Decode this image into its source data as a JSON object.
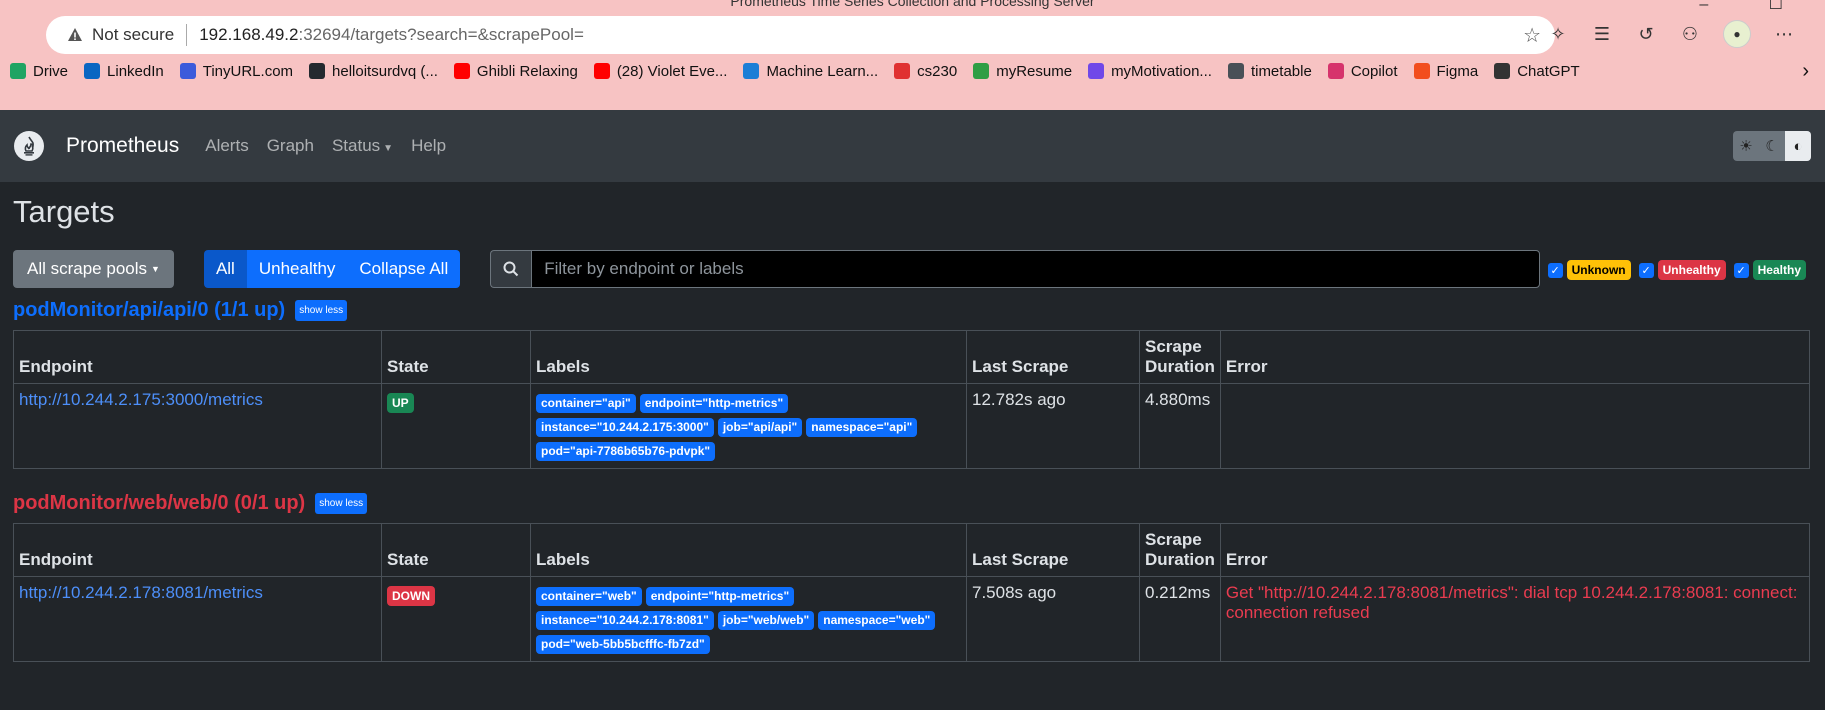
{
  "browser": {
    "window_title": "Prometheus Time Series Collection and Processing Server",
    "not_secure": "Not secure",
    "url_host": "192.168.49.2",
    "url_rest": ":32694/targets?search=&scrapePool=",
    "bookmarks": [
      {
        "label": "Drive",
        "color": "#1fa463"
      },
      {
        "label": "LinkedIn",
        "color": "#0a66c2"
      },
      {
        "label": "TinyURL.com",
        "color": "#3b5bdb"
      },
      {
        "label": "helloitsurdvq (...",
        "color": "#24292f"
      },
      {
        "label": "Ghibli Relaxing",
        "color": "#ff0000"
      },
      {
        "label": "(28) Violet Eve...",
        "color": "#ff0000"
      },
      {
        "label": "Machine Learn...",
        "color": "#1c7ed6"
      },
      {
        "label": "cs230",
        "color": "#e03131"
      },
      {
        "label": "myResume",
        "color": "#2f9e44"
      },
      {
        "label": "myMotivation...",
        "color": "#7048e8"
      },
      {
        "label": "timetable",
        "color": "#495057"
      },
      {
        "label": "Copilot",
        "color": "#d6336c"
      },
      {
        "label": "Figma",
        "color": "#f24e1e"
      },
      {
        "label": "ChatGPT",
        "color": "#333333"
      }
    ]
  },
  "nav": {
    "brand": "Prometheus",
    "links": [
      "Alerts",
      "Graph",
      "Status",
      "Help"
    ]
  },
  "page": {
    "title": "Targets",
    "scrape_pools_button": "All scrape pools",
    "filter_buttons": [
      "All",
      "Unhealthy",
      "Collapse All"
    ],
    "search_placeholder": "Filter by endpoint or labels",
    "health_filters": [
      "Unknown",
      "Unhealthy",
      "Healthy"
    ]
  },
  "table_headers": {
    "endpoint": "Endpoint",
    "state": "State",
    "labels": "Labels",
    "last_scrape": "Last Scrape",
    "scrape_duration": "Scrape Duration",
    "error": "Error"
  },
  "pools": [
    {
      "title": "podMonitor/api/api/0 (1/1 up)",
      "status": "ok",
      "toggle": "show less",
      "rows": [
        {
          "endpoint": "http://10.244.2.175:3000/metrics",
          "state": "UP",
          "labels": [
            "container=\"api\"",
            "endpoint=\"http-metrics\"",
            "instance=\"10.244.2.175:3000\"",
            "job=\"api/api\"",
            "namespace=\"api\"",
            "pod=\"api-7786b65b76-pdvpk\""
          ],
          "last_scrape": "12.782s ago",
          "duration": "4.880ms",
          "error": ""
        }
      ]
    },
    {
      "title": "podMonitor/web/web/0 (0/1 up)",
      "status": "bad",
      "toggle": "show less",
      "rows": [
        {
          "endpoint": "http://10.244.2.178:8081/metrics",
          "state": "DOWN",
          "labels": [
            "container=\"web\"",
            "endpoint=\"http-metrics\"",
            "instance=\"10.244.2.178:8081\"",
            "job=\"web/web\"",
            "namespace=\"web\"",
            "pod=\"web-5bb5bcfffc-fb7zd\""
          ],
          "last_scrape": "7.508s ago",
          "duration": "0.212ms",
          "error": "Get \"http://10.244.2.178:8081/metrics\": dial tcp 10.244.2.178:8081: connect: connection refused"
        }
      ]
    }
  ]
}
